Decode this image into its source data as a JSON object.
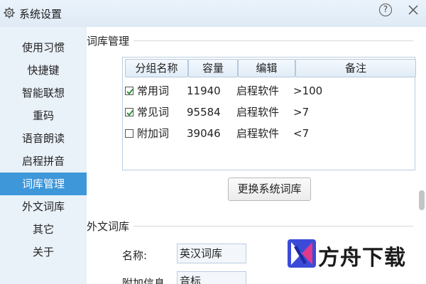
{
  "window": {
    "title": "系统设置",
    "help_label": "?"
  },
  "sidebar": {
    "items": [
      {
        "label": "使用习惯"
      },
      {
        "label": "快捷键"
      },
      {
        "label": "智能联想"
      },
      {
        "label": "重码"
      },
      {
        "label": "语音朗读"
      },
      {
        "label": "启程拼音"
      },
      {
        "label": "词库管理",
        "active": true
      },
      {
        "label": "外文词库"
      },
      {
        "label": "其它"
      },
      {
        "label": "关于"
      }
    ]
  },
  "lexicon": {
    "section_title": "词库管理",
    "columns": [
      "分组名称",
      "容量",
      "编辑",
      "备注"
    ],
    "rows": [
      {
        "checked": true,
        "name": "常用词",
        "capacity": "11940",
        "editor": "启程软件",
        "note": ">100"
      },
      {
        "checked": true,
        "name": "常见词",
        "capacity": "95584",
        "editor": "启程软件",
        "note": ">7"
      },
      {
        "checked": false,
        "name": "附加词",
        "capacity": "39046",
        "editor": "启程软件",
        "note": "<7"
      }
    ],
    "switch_button": "更换系统词库"
  },
  "foreign": {
    "section_title": "外文词库",
    "name_label": "名称:",
    "name_value": "英汉词库",
    "extra_label": "附加信息",
    "extra_value": "音标"
  },
  "watermark": {
    "text": "方舟下载"
  },
  "colors": {
    "accent": "#3e97d9",
    "sidebar_bg": "#e9f1f9",
    "titlebar_bg": "#e4eef8"
  }
}
